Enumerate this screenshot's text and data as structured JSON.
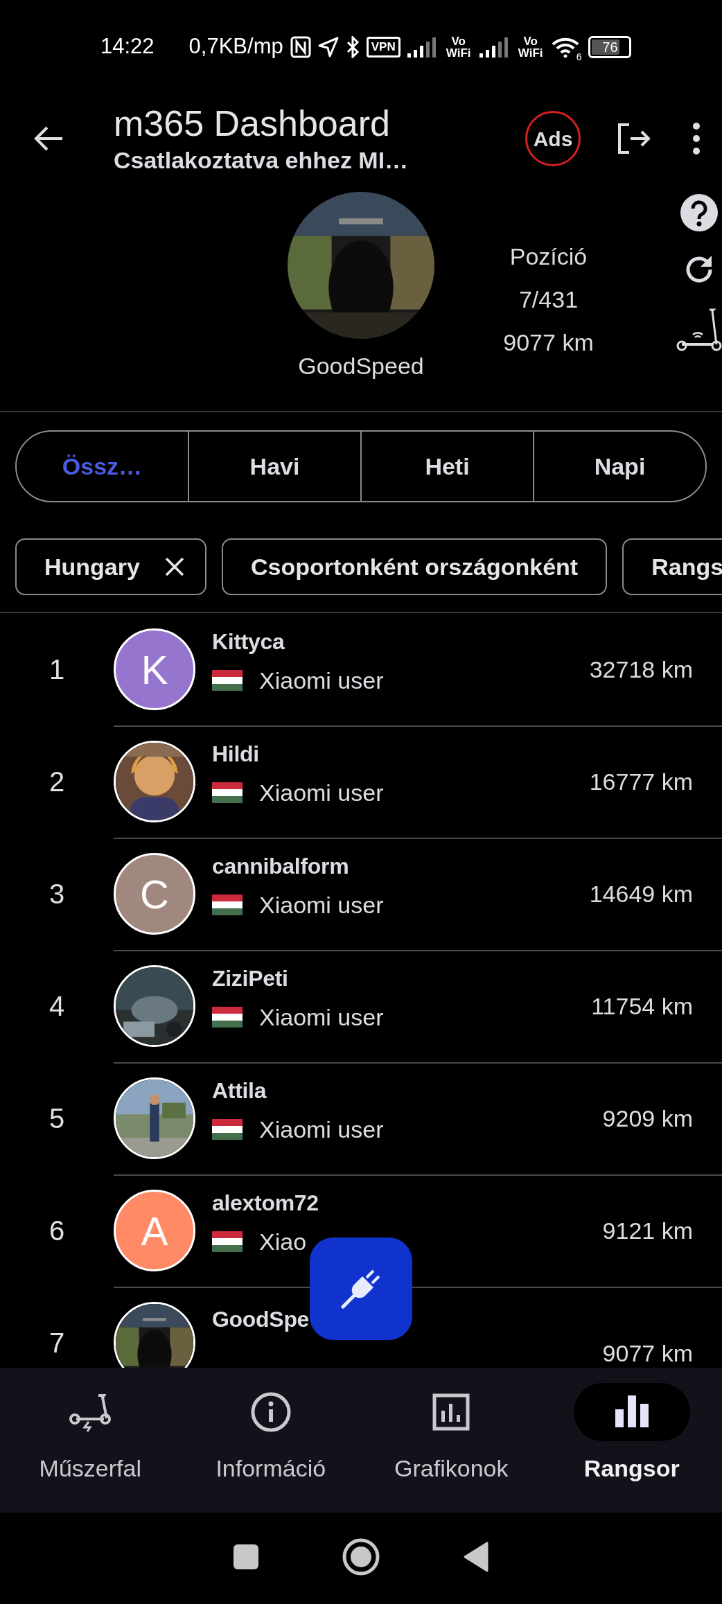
{
  "status_bar": {
    "time": "14:22",
    "speed": "0,7KB/mp",
    "vpn": "VPN",
    "volte": [
      "Vo WiFi",
      "Vo WiFi"
    ],
    "wifi_badge": "6",
    "battery": "76"
  },
  "app_bar": {
    "title": "m365 Dashboard",
    "subtitle": "Csatlakoztatva ehhez MI…",
    "ads_label": "Ads"
  },
  "profile": {
    "name": "GoodSpeed",
    "position_label": "Pozíció",
    "position": "7/431",
    "distance": "9077 km"
  },
  "tabs": [
    {
      "label": "Össz…",
      "selected": true
    },
    {
      "label": "Havi",
      "selected": false
    },
    {
      "label": "Heti",
      "selected": false
    },
    {
      "label": "Napi",
      "selected": false
    }
  ],
  "chips": [
    {
      "label": "Hungary",
      "closable": true
    },
    {
      "label": "Csoportonként országonként",
      "closable": false
    },
    {
      "label": "Rangs"
    }
  ],
  "rows": [
    {
      "rank": "1",
      "name": "Kittyca",
      "subtitle": "Xiaomi user",
      "distance": "32718 km",
      "avatar": {
        "kind": "letter",
        "letter": "K",
        "color": "#9575cd"
      }
    },
    {
      "rank": "2",
      "name": "Hildi",
      "subtitle": "Xiaomi user",
      "distance": "16777 km"
    },
    {
      "rank": "3",
      "name": "cannibalform",
      "subtitle": "Xiaomi user",
      "distance": "14649 km",
      "avatar": {
        "kind": "letter",
        "letter": "C",
        "color": "#a1887f"
      }
    },
    {
      "rank": "4",
      "name": "ZiziPeti",
      "subtitle": "Xiaomi user",
      "distance": "11754 km"
    },
    {
      "rank": "5",
      "name": "Attila",
      "subtitle": "Xiaomi user",
      "distance": "9209 km"
    },
    {
      "rank": "6",
      "name": "alextom72",
      "subtitle": "Xiao",
      "distance": "9121 km",
      "avatar": {
        "kind": "letter",
        "letter": "A",
        "color": "#ff8a65"
      }
    },
    {
      "rank": "7",
      "name": "GoodSpe",
      "distance": "9077 km"
    }
  ],
  "bottom_nav": [
    {
      "label": "Műszerfal",
      "selected": false
    },
    {
      "label": "Információ",
      "selected": false
    },
    {
      "label": "Grafikonok",
      "selected": false
    },
    {
      "label": "Rangsor",
      "selected": true
    }
  ]
}
